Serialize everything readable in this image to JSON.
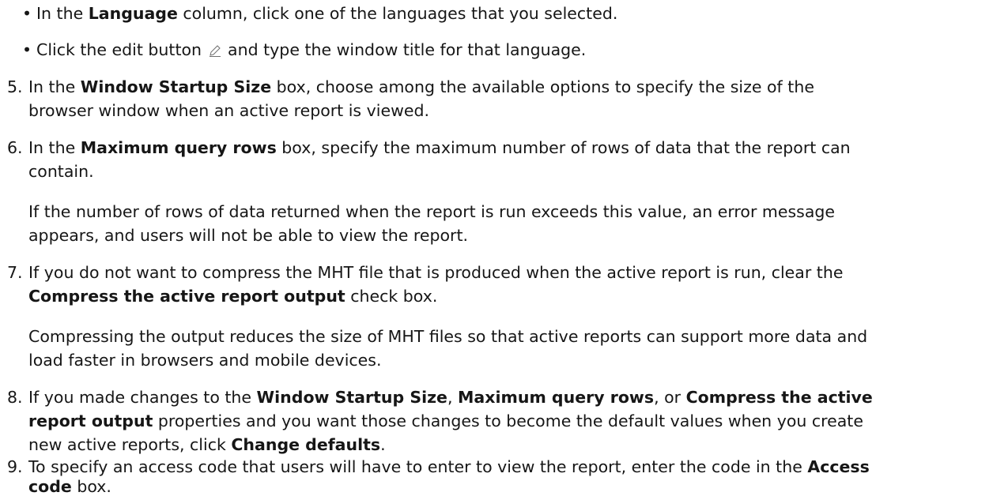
{
  "sub_bullets": [
    {
      "marker": "•",
      "pre": "In the ",
      "bold": "Language",
      "post": " column, click one of the languages that you selected."
    },
    {
      "marker": "•",
      "pre": "Click the edit button ",
      "icon": "pencil-icon",
      "post": " and type the window title for that language."
    }
  ],
  "steps": [
    {
      "number": "5.",
      "lines": [
        {
          "pre": "In the ",
          "bold": "Window Startup Size",
          "post": " box, choose among the available options to specify the size of the"
        },
        {
          "pre": "browser window when an active report is viewed."
        }
      ]
    },
    {
      "number": "6.",
      "lines": [
        {
          "pre": "In the ",
          "bold": "Maximum query rows",
          "post": " box, specify the maximum number of rows of data that the report can"
        },
        {
          "pre": "contain."
        }
      ],
      "note": [
        "If the number of rows of data returned when the report is run exceeds this value, an error message",
        "appears, and users will not be able to view the report."
      ]
    },
    {
      "number": "7.",
      "lines": [
        {
          "pre": "If you do not want to compress the MHT file that is produced when the active report is run, clear the"
        },
        {
          "bold": "Compress the active report output",
          "post": " check box."
        }
      ],
      "note": [
        "Compressing the output reduces the size of MHT files so that active reports can support more data and",
        "load faster in browsers and mobile devices."
      ]
    },
    {
      "number": "8.",
      "lines": [
        {
          "pre": "If you made changes to the ",
          "bold": "Window Startup Size",
          "mid": ", ",
          "bold2": "Maximum query rows",
          "mid2": ", or ",
          "bold3": "Compress the active"
        },
        {
          "bold": "report output",
          "post": " properties and you want those changes to become the default values when you create"
        },
        {
          "pre": "new active reports, click ",
          "bold": "Change defaults",
          "post": "."
        }
      ]
    },
    {
      "number": "9.",
      "lines": [
        {
          "pre": "To specify an access code that users will have to enter to view the report, enter the code in the ",
          "bold": "Access"
        },
        {
          "bold": "code",
          "post": " box."
        }
      ]
    }
  ]
}
